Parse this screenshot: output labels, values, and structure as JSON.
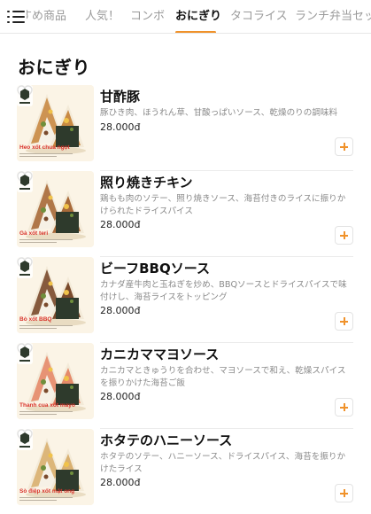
{
  "tabs": [
    {
      "label": "すすめ商品",
      "active": false
    },
    {
      "label": "人気！",
      "active": false
    },
    {
      "label": "コンボ",
      "active": false
    },
    {
      "label": "おにぎり",
      "active": true
    },
    {
      "label": "タコライス",
      "active": false
    },
    {
      "label": "ランチ弁当セット",
      "active": false
    }
  ],
  "section_title": "おにぎり",
  "items": [
    {
      "name": "甘酢豚",
      "description": "豚ひき肉、ほうれん草、甘酸っぱいソース、乾燥のりの調味料",
      "price": "28.000đ",
      "caption": "Heo xốt chua ngọt",
      "brand": "YaNori",
      "filling_color": "#c98a44"
    },
    {
      "name": "照り焼きチキン",
      "description": "鶏もも肉のソテー、照り焼きソース、海苔付きのライスに振りかけられたドライスパイス",
      "price": "28.000đ",
      "caption": "Gà xốt teri",
      "brand": "YaNori",
      "filling_color": "#a86a3a"
    },
    {
      "name": "ビーフBBQソース",
      "description": "カナダ産牛肉と玉ねぎを炒め、BBQソースとドライスパイスで味付けし、海苔ライスをトッピング",
      "price": "28.000đ",
      "caption": "Bò xốt BBQ",
      "brand": "YaNori",
      "filling_color": "#7a4a2c"
    },
    {
      "name": "カニカママヨソース",
      "description": "カニカマときゅうりを合わせ、マヨソースで和え、乾燥スパイスを振りかけた海苔ご飯",
      "price": "28.000đ",
      "caption": "Thanh cua xốt mayo",
      "brand": "YaNori",
      "filling_color": "#e58a6a"
    },
    {
      "name": "ホタテのハニーソース",
      "description": "ホタテのソテー、ハニーソース、ドライスパイス、海苔を振りかけたライス",
      "price": "28.000đ",
      "caption": "Sò điệp xốt mật ong",
      "brand": "YaNori",
      "filling_color": "#d9b070"
    }
  ],
  "colors": {
    "accent": "#f0922b",
    "caption_red": "#d8322a",
    "thumb_bg": "#fbf4e6",
    "nori": "#2e3a2c"
  },
  "icons": {
    "menu": "hamburger-icon",
    "favorite": "heart-outline-icon",
    "add": "plus-icon"
  }
}
